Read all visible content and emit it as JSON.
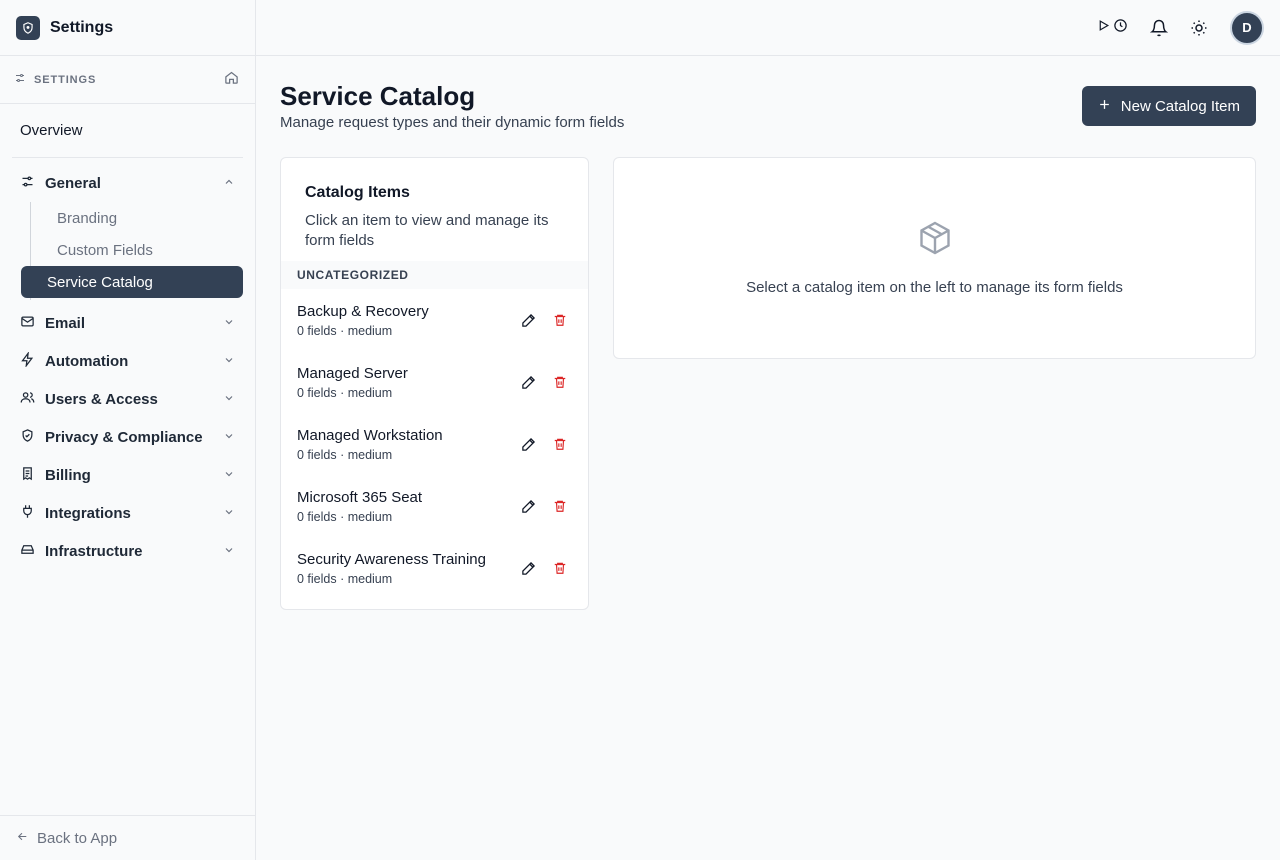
{
  "sidebar": {
    "brand_title": "Settings",
    "section_label": "SETTINGS",
    "overview": "Overview",
    "groups": [
      {
        "label": "General",
        "icon": "sliders-icon",
        "expanded": true,
        "children": [
          "Branding",
          "Custom Fields",
          "Service Catalog"
        ]
      },
      {
        "label": "Email",
        "icon": "mail-icon"
      },
      {
        "label": "Automation",
        "icon": "zap-icon"
      },
      {
        "label": "Users & Access",
        "icon": "users-icon"
      },
      {
        "label": "Privacy & Compliance",
        "icon": "shield-icon"
      },
      {
        "label": "Billing",
        "icon": "receipt-icon"
      },
      {
        "label": "Integrations",
        "icon": "plug-icon"
      },
      {
        "label": "Infrastructure",
        "icon": "hard-drive-icon"
      }
    ],
    "active_item": "Service Catalog",
    "back_label": "Back to App"
  },
  "topbar": {
    "avatar_initial": "D"
  },
  "page": {
    "title": "Service Catalog",
    "subtitle": "Manage request types and their dynamic form fields",
    "new_button": "New Catalog Item"
  },
  "catalog": {
    "title": "Catalog Items",
    "description": "Click an item to view and manage its form fields",
    "category": "UNCATEGORIZED",
    "items": [
      {
        "name": "Backup & Recovery",
        "meta": "0 fields · medium"
      },
      {
        "name": "Managed Server",
        "meta": "0 fields · medium"
      },
      {
        "name": "Managed Workstation",
        "meta": "0 fields · medium"
      },
      {
        "name": "Microsoft 365 Seat",
        "meta": "0 fields · medium"
      },
      {
        "name": "Security Awareness Training",
        "meta": "0 fields · medium"
      }
    ]
  },
  "detail": {
    "empty_text": "Select a catalog item on the left to manage its form fields"
  },
  "colors": {
    "primary": "#334155",
    "danger": "#dc2626",
    "muted": "#6b7280",
    "border": "#e5e7eb"
  }
}
